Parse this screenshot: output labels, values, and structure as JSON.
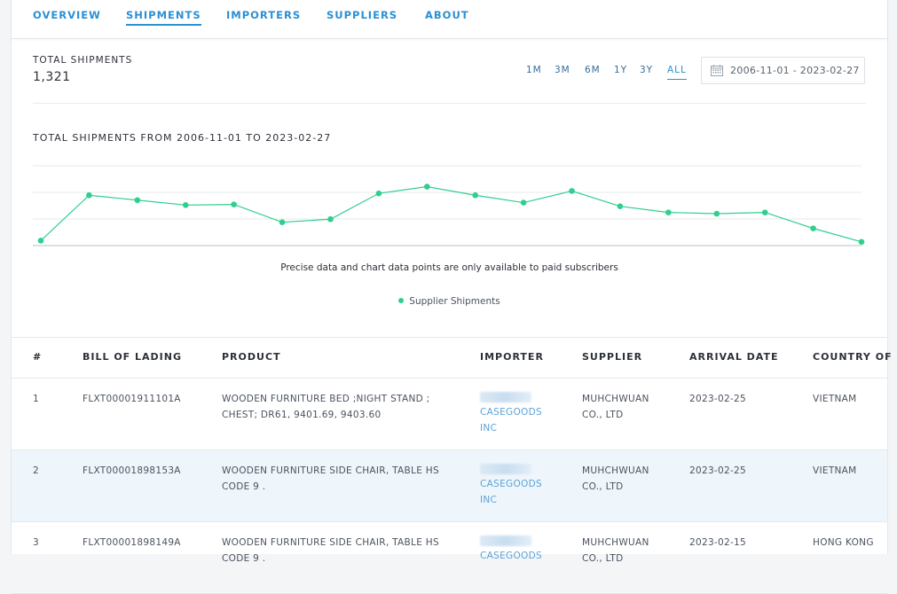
{
  "nav": {
    "tabs": [
      {
        "label": "OVERVIEW",
        "active": false
      },
      {
        "label": "SHIPMENTS",
        "active": true
      },
      {
        "label": "IMPORTERS",
        "active": false
      },
      {
        "label": "SUPPLIERS",
        "active": false
      },
      {
        "label": "ABOUT",
        "active": false
      }
    ]
  },
  "summary": {
    "label": "TOTAL SHIPMENTS",
    "value": "1,321"
  },
  "ranges": [
    {
      "label": "1M",
      "active": false
    },
    {
      "label": "3M",
      "active": false
    },
    {
      "label": "6M",
      "active": false
    },
    {
      "label": "1Y",
      "active": false
    },
    {
      "label": "3Y",
      "active": false
    },
    {
      "label": "ALL",
      "active": true
    }
  ],
  "date_range": {
    "icon": "calendar-icon",
    "value": "2006-11-01 - 2023-02-27"
  },
  "chart_section": {
    "title": "TOTAL SHIPMENTS FROM 2006-11-01 TO 2023-02-27",
    "note": "Precise data and chart data points are only available to paid subscribers",
    "legend_label": "Supplier Shipments"
  },
  "chart_data": {
    "type": "line",
    "series": [
      {
        "name": "Supplier Shipments",
        "color": "#2fcf8f",
        "values": [
          0.08,
          0.82,
          0.74,
          0.66,
          0.67,
          0.38,
          0.43,
          0.85,
          0.96,
          0.82,
          0.7,
          0.89,
          0.64,
          0.54,
          0.52,
          0.54,
          0.28,
          0.06
        ]
      }
    ],
    "ylim": [
      0,
      1.3
    ],
    "grid": true,
    "xlabel": "",
    "ylabel": ""
  },
  "table": {
    "columns": [
      "#",
      "BILL OF LADING",
      "PRODUCT",
      "IMPORTER",
      "SUPPLIER",
      "ARRIVAL DATE",
      "COUNTRY OF"
    ],
    "rows": [
      {
        "num": "1",
        "bol": "FLXT00001911101A",
        "product": "WOODEN FURNITURE BED ;NIGHT STAND ; CHEST; DR61, 9401.69, 9403.60",
        "importer_line1": "CASEGOODS",
        "importer_line2": "INC",
        "supplier": "MUHCHWUAN CO., LTD",
        "arrival": "2023-02-25",
        "country": "VIETNAM"
      },
      {
        "num": "2",
        "bol": "FLXT00001898153A",
        "product": "WOODEN FURNITURE SIDE CHAIR, TABLE HS CODE 9 .",
        "importer_line1": "CASEGOODS",
        "importer_line2": "INC",
        "supplier": "MUHCHWUAN CO., LTD",
        "arrival": "2023-02-25",
        "country": "VIETNAM"
      },
      {
        "num": "3",
        "bol": "FLXT00001898149A",
        "product": "WOODEN FURNITURE SIDE CHAIR, TABLE HS CODE 9 .",
        "importer_line1": "CASEGOODS",
        "importer_line2": "",
        "supplier": "MUHCHWUAN CO., LTD",
        "arrival": "2023-02-15",
        "country": "HONG KONG"
      }
    ]
  }
}
